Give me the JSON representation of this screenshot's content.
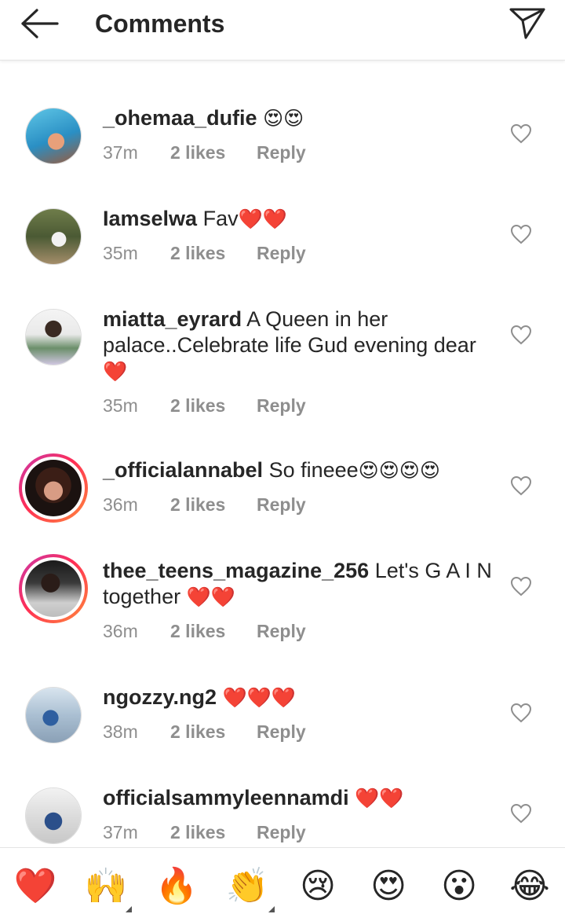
{
  "header": {
    "title": "Comments"
  },
  "comments": [
    {
      "user": "_ohemaa_dufie",
      "text": "",
      "emojis": "😍😍",
      "time": "37m",
      "likes": "2 likes",
      "reply": "Reply"
    },
    {
      "user": "Iamselwa",
      "text": "Fav",
      "emojis": "❤️❤️",
      "time": "35m",
      "likes": "2 likes",
      "reply": "Reply"
    },
    {
      "user": "miatta_eyrard",
      "text": "A Queen in her palace..Celebrate life Gud evening dear",
      "emojis": "❤️",
      "time": "35m",
      "likes": "2 likes",
      "reply": "Reply"
    },
    {
      "user": "_officialannabel",
      "text": "So fineee",
      "emojis": "😍😍😍😍",
      "time": "36m",
      "likes": "2 likes",
      "reply": "Reply"
    },
    {
      "user": "thee_teens_magazine_256",
      "text": "Let's G A I N together",
      "emojis": "❤️❤️",
      "time": "36m",
      "likes": "2 likes",
      "reply": "Reply"
    },
    {
      "user": "ngozzy.ng2",
      "text": "",
      "emojis": "❤️❤️❤️",
      "time": "38m",
      "likes": "2 likes",
      "reply": "Reply"
    },
    {
      "user": "officialsammyleennamdi",
      "text": "",
      "emojis": "❤️❤️",
      "time": "37m",
      "likes": "2 likes",
      "reply": "Reply"
    }
  ],
  "emoji_bar": [
    "❤️",
    "🙌",
    "🔥",
    "👏",
    "😢",
    "😍",
    "😮",
    "😂"
  ],
  "colors": {
    "text": "#262626",
    "meta": "#8e8e8e",
    "story_ring_start": "#c837ab",
    "story_ring_end": "#ff8a3a"
  }
}
